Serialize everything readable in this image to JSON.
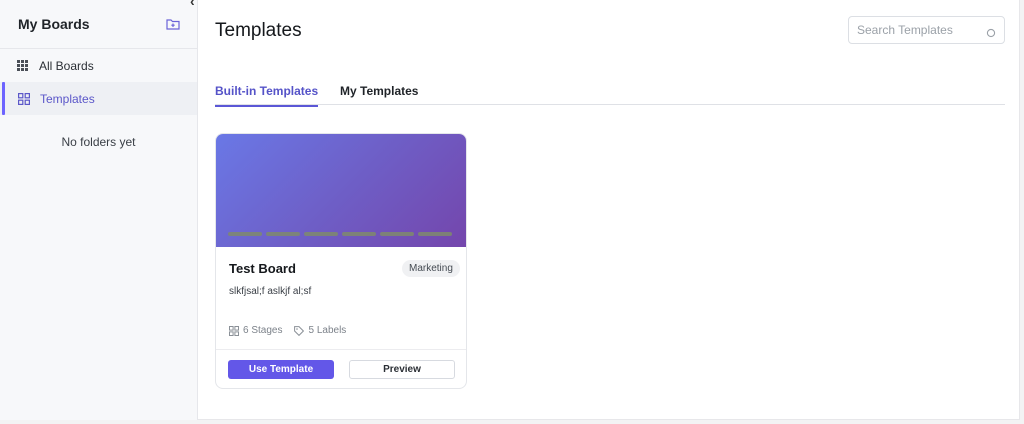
{
  "sidebar": {
    "title": "My Boards",
    "items": [
      {
        "label": "All Boards",
        "icon": "grid-dots-icon"
      },
      {
        "label": "Templates",
        "icon": "templates-icon"
      }
    ],
    "empty_text": "No folders yet"
  },
  "main": {
    "title": "Templates",
    "search": {
      "placeholder": "Search Templates",
      "value": ""
    },
    "tabs": [
      {
        "label": "Built-in Templates",
        "active": true
      },
      {
        "label": "My Templates",
        "active": false
      }
    ]
  },
  "cards": [
    {
      "name": "Test Board",
      "tag": "Marketing",
      "description": "slkfjsal;f aslkjf al;sf",
      "stages": "6 Stages",
      "labels": "5 Labels",
      "use_label": "Use Template",
      "preview_label": "Preview"
    }
  ],
  "colors": {
    "accent": "#6357e8",
    "tab_active": "#5553c8",
    "banner_start": "#6a78e6",
    "banner_end": "#7446ac"
  }
}
